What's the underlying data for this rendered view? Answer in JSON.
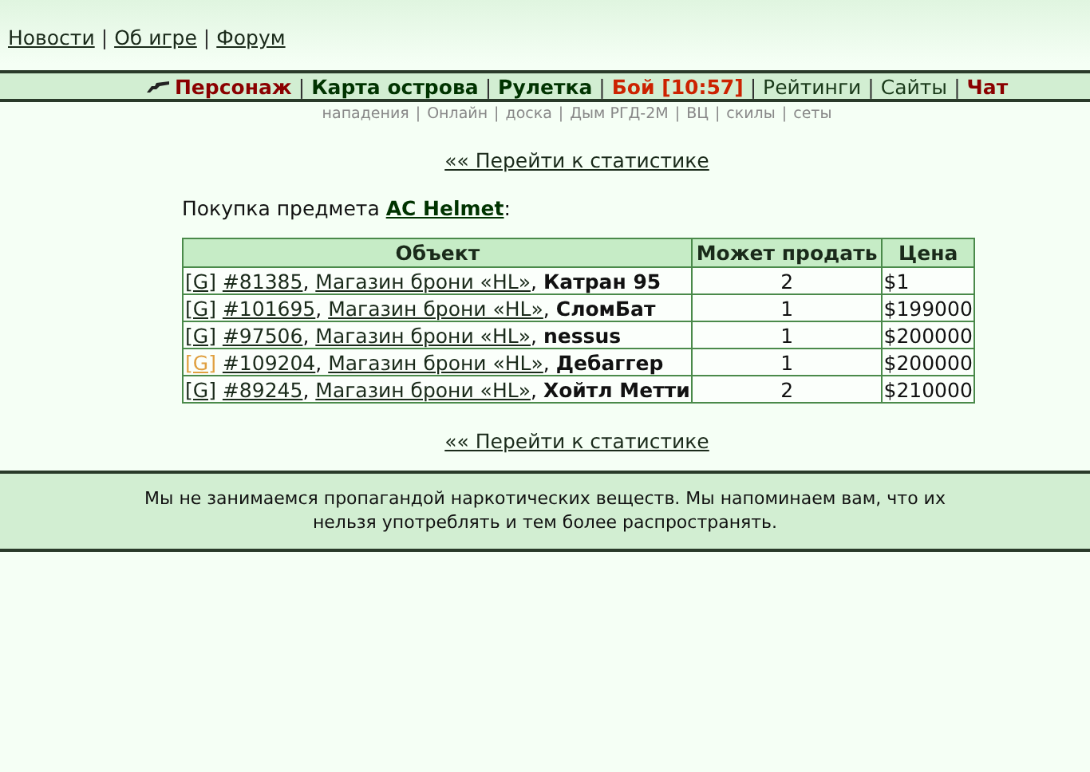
{
  "top_links": [
    "Новости",
    "Об игре",
    "Форум"
  ],
  "separator": "|",
  "comma": ",",
  "nav": [
    {
      "label": "Персонаж",
      "color": "#8b0000",
      "bold": true,
      "icon": true
    },
    {
      "label": "Карта острова",
      "color": "#003300",
      "bold": true,
      "icon": false
    },
    {
      "label": "Рулетка",
      "color": "#003300",
      "bold": true,
      "icon": false
    },
    {
      "label": "Бой [10:57]",
      "color": "#cc2200",
      "bold": true,
      "icon": false
    },
    {
      "label": "Рейтинги",
      "color": "#1a3a1a",
      "bold": false,
      "icon": false
    },
    {
      "label": "Сайты",
      "color": "#1a3a1a",
      "bold": false,
      "icon": false
    },
    {
      "label": "Чат",
      "color": "#8b0000",
      "bold": true,
      "icon": false
    }
  ],
  "sub_nav": [
    "нападения",
    "Онлайн",
    "доска",
    "Дым РГД-2М",
    "ВЦ",
    "скилы",
    "сеты"
  ],
  "stats_link_top": "«« Перейти к статистике",
  "purchase": {
    "label": "Покупка предмета",
    "item": "AC Helmet",
    "suffix": ":"
  },
  "table": {
    "columns": [
      "Объект",
      "Может продать",
      "Цена"
    ],
    "rows": [
      {
        "g": "[G]",
        "highlighted": false,
        "id": "#81385",
        "shop": "Магазин брони «HL»",
        "owner": "Катран 95",
        "qty": "2",
        "price": "$1"
      },
      {
        "g": "[G]",
        "highlighted": false,
        "id": "#101695",
        "shop": "Магазин брони «HL»",
        "owner": "СломБат",
        "qty": "1",
        "price": "$199000"
      },
      {
        "g": "[G]",
        "highlighted": false,
        "id": "#97506",
        "shop": "Магазин брони «HL»",
        "owner": "nessus",
        "qty": "1",
        "price": "$200000"
      },
      {
        "g": "[G]",
        "highlighted": true,
        "id": "#109204",
        "shop": "Магазин брони «HL»",
        "owner": "Дебаггер",
        "qty": "1",
        "price": "$200000"
      },
      {
        "g": "[G]",
        "highlighted": false,
        "id": "#89245",
        "shop": "Магазин брони «HL»",
        "owner": "Хойтл Метти",
        "qty": "2",
        "price": "$210000"
      }
    ]
  },
  "stats_link_bottom": "«« Перейти к статистике",
  "footer": "Мы не занимаемся пропагандой наркотических веществ. Мы напоминаем вам, что их нельзя употреблять и тем более распространять."
}
